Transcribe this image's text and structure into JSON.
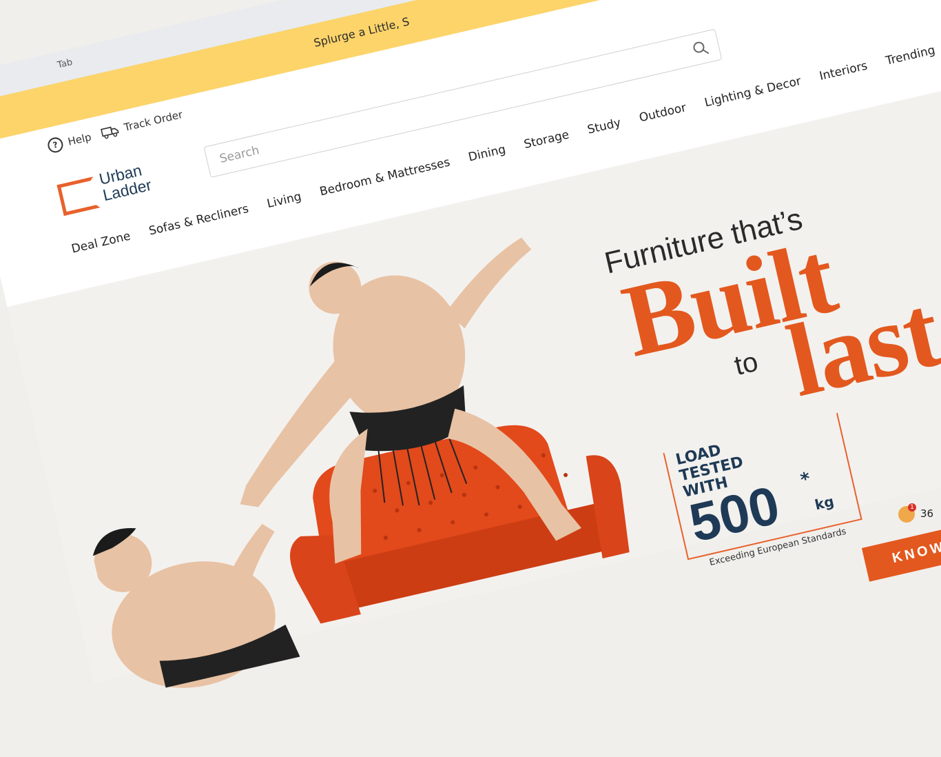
{
  "browser": {
    "tab_label": "Tab"
  },
  "promo": {
    "text": "Splurge a Little, S"
  },
  "header": {
    "help_label": "Help",
    "track_order_label": "Track Order",
    "logo_line1": "Urban",
    "logo_line2": "Ladder",
    "search_placeholder": "Search"
  },
  "nav": {
    "items": [
      "Deal Zone",
      "Sofas & Recliners",
      "Living",
      "Bedroom & Mattresses",
      "Dining",
      "Storage",
      "Study",
      "Outdoor",
      "Lighting & Decor",
      "Interiors",
      "Trending"
    ]
  },
  "hero": {
    "headline_line1": "Furniture that’s",
    "headline_big1": "Built",
    "headline_to": "to",
    "headline_big2": "last",
    "badge_line1": "LOAD",
    "badge_line2": "TESTED",
    "badge_line3": "WITH",
    "badge_number": "500",
    "badge_star": "*",
    "badge_unit": "kg",
    "badge_caption": "Exceeding European Standards",
    "cta_label": "KNOW MO"
  },
  "tray": {
    "badge_count": "1",
    "text": "36"
  },
  "colors": {
    "brand_orange": "#e3581e",
    "promo_yellow": "#fcd46a",
    "navy": "#1e3a56"
  }
}
